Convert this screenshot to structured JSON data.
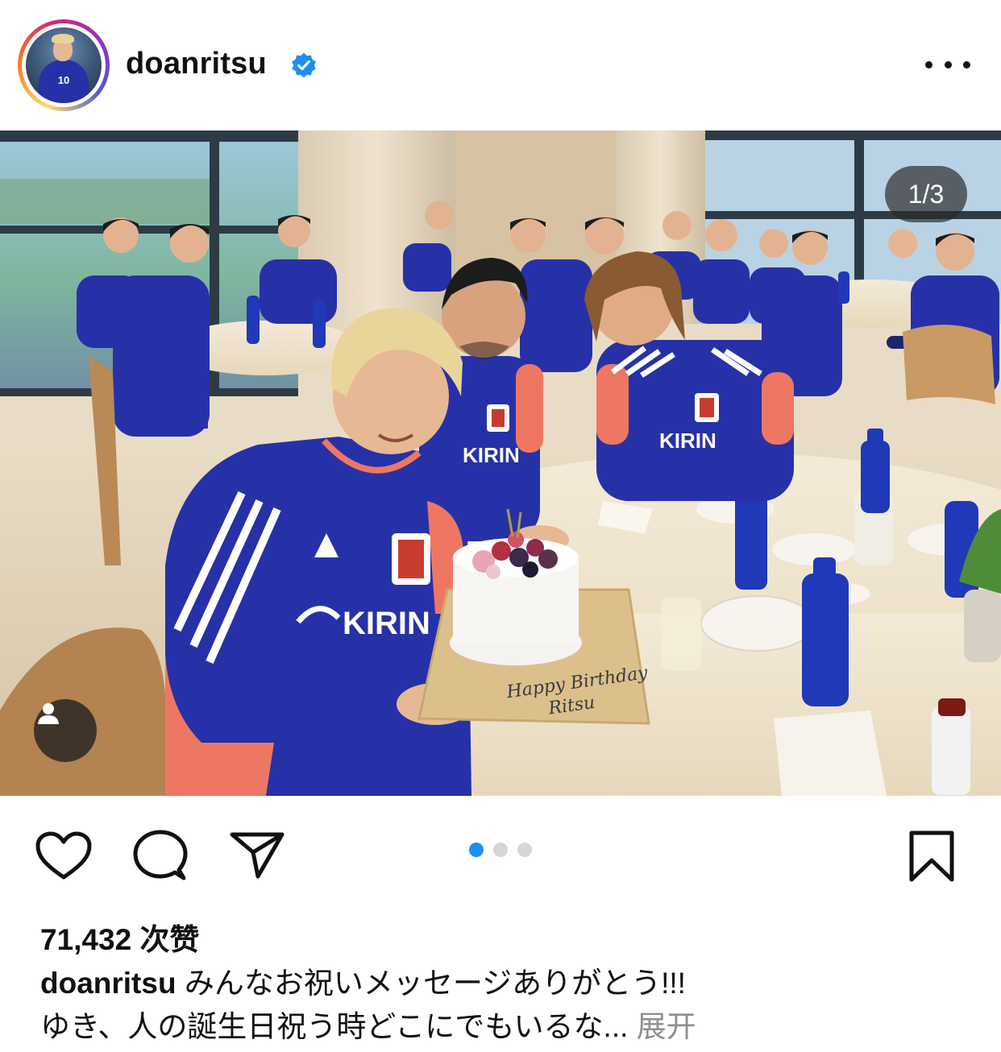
{
  "post": {
    "username": "doanritsu",
    "verified": true,
    "avatar_jersey_number": "10",
    "image_counter": "1/3",
    "likes": "71,432 次赞",
    "caption_user": "doanritsu",
    "caption_line1": "みんなお祝いメッセージありがとう!!!",
    "caption_line2": "ゆき、人の誕生日祝う時どこにでもいるな...",
    "expand_label": "展开",
    "carousel": {
      "total": 3,
      "active_index": 0
    },
    "cake_message": "Happy Birthday Ritsu",
    "jersey_sponsor": "KIRIN"
  },
  "icons": {
    "more": "more-horizontal-icon",
    "verified": "verified-badge-icon",
    "tag": "user-tag-icon",
    "like": "heart-icon",
    "comment": "comment-icon",
    "share": "send-icon",
    "save": "bookmark-icon"
  },
  "colors": {
    "verified_blue": "#1d8ff2",
    "jersey_blue": "#2631a8",
    "sleeve_coral": "#ee7763",
    "active_dot": "#1d8ff2",
    "inactive_dot": "#d6d6d6",
    "muted_text": "#8e8e8e"
  }
}
